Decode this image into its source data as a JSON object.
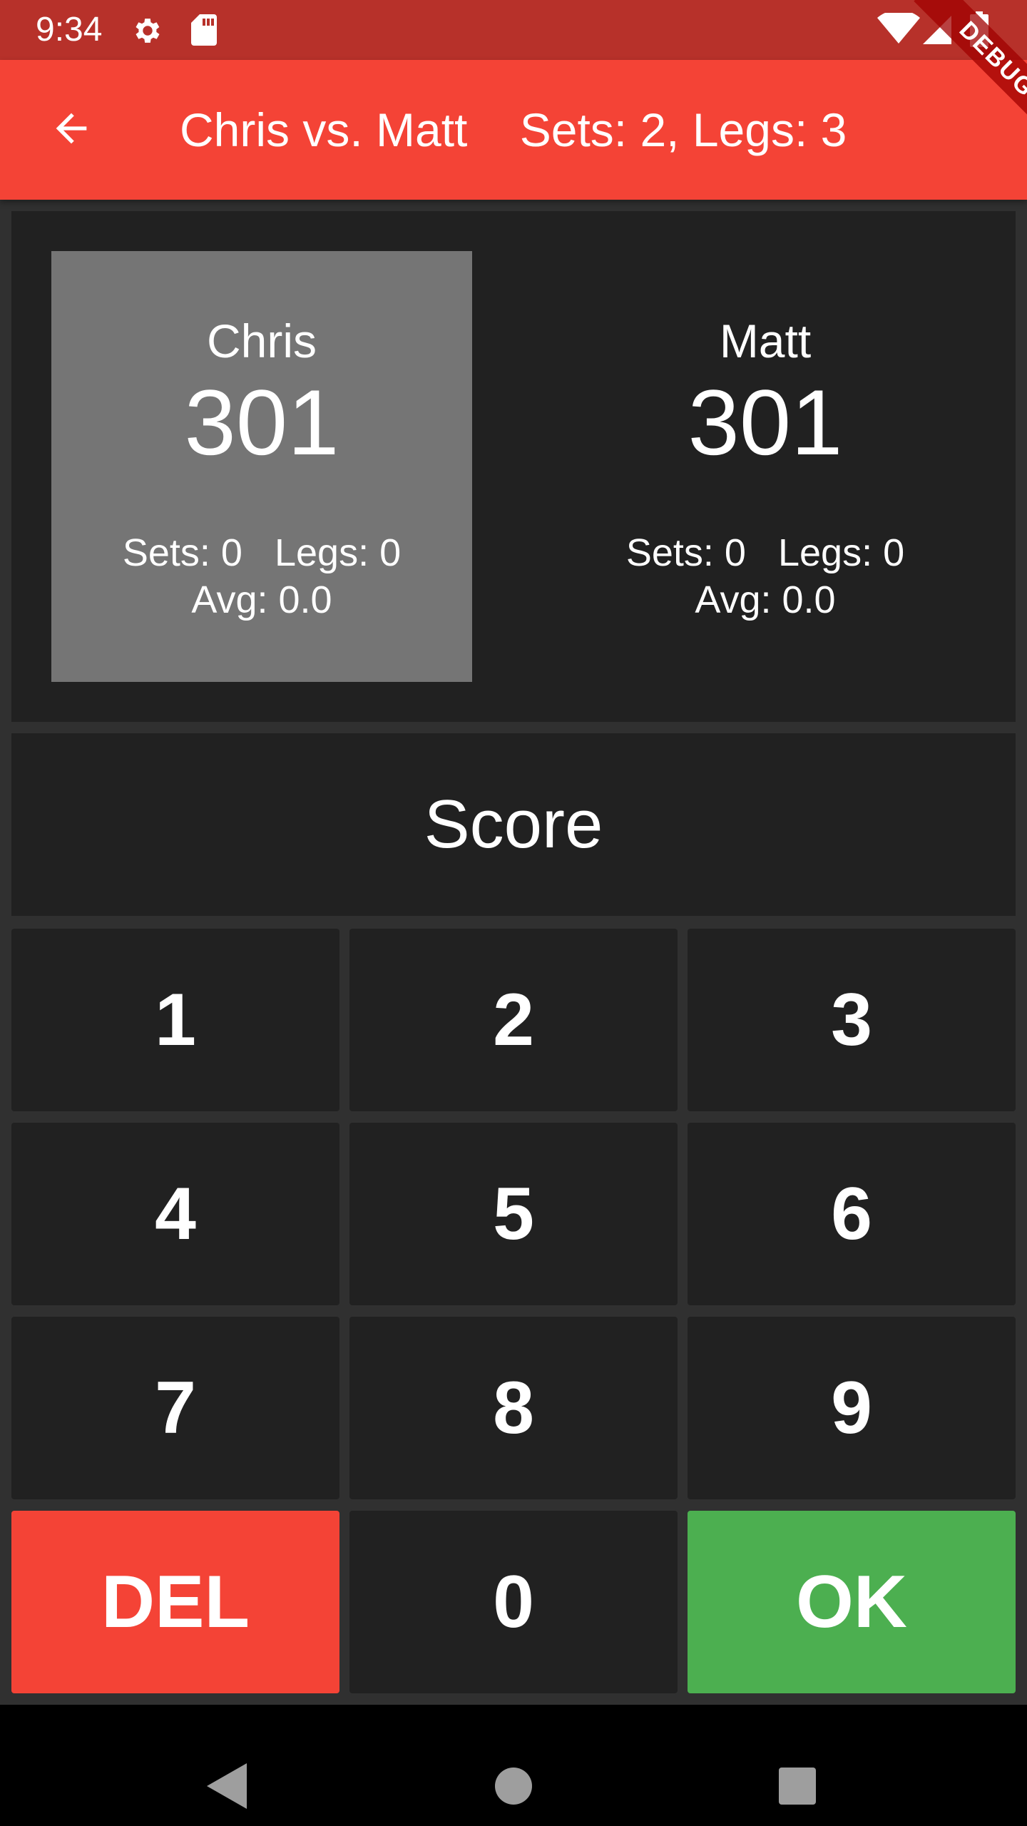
{
  "status_bar": {
    "time": "9:34",
    "icons": [
      "gear-icon",
      "sd-card-icon",
      "wifi-icon",
      "cell-signal-icon",
      "battery-icon"
    ]
  },
  "debug_banner": "DEBUG",
  "app_bar": {
    "title": "Chris vs. Matt    Sets: 2, Legs: 3",
    "back_icon": "arrow-back-icon"
  },
  "players": [
    {
      "name": "Chris",
      "score": "301",
      "stats": "Sets: 0   Legs: 0",
      "avg": "Avg: 0.0",
      "active": true
    },
    {
      "name": "Matt",
      "score": "301",
      "stats": "Sets: 0   Legs: 0",
      "avg": "Avg: 0.0",
      "active": false
    }
  ],
  "score_display": "Score",
  "keypad": {
    "k1": "1",
    "k2": "2",
    "k3": "3",
    "k4": "4",
    "k5": "5",
    "k6": "6",
    "k7": "7",
    "k8": "8",
    "k9": "9",
    "del": "DEL",
    "k0": "0",
    "ok": "OK"
  },
  "colors": {
    "primary": "#f44336",
    "status_bar": "#b7312a",
    "active_player": "#757575",
    "ok": "#4caf50",
    "panel": "#212121",
    "background": "#303030"
  },
  "nav_bar": {
    "icons": [
      "nav-back-icon",
      "nav-home-icon",
      "nav-recents-icon"
    ]
  }
}
